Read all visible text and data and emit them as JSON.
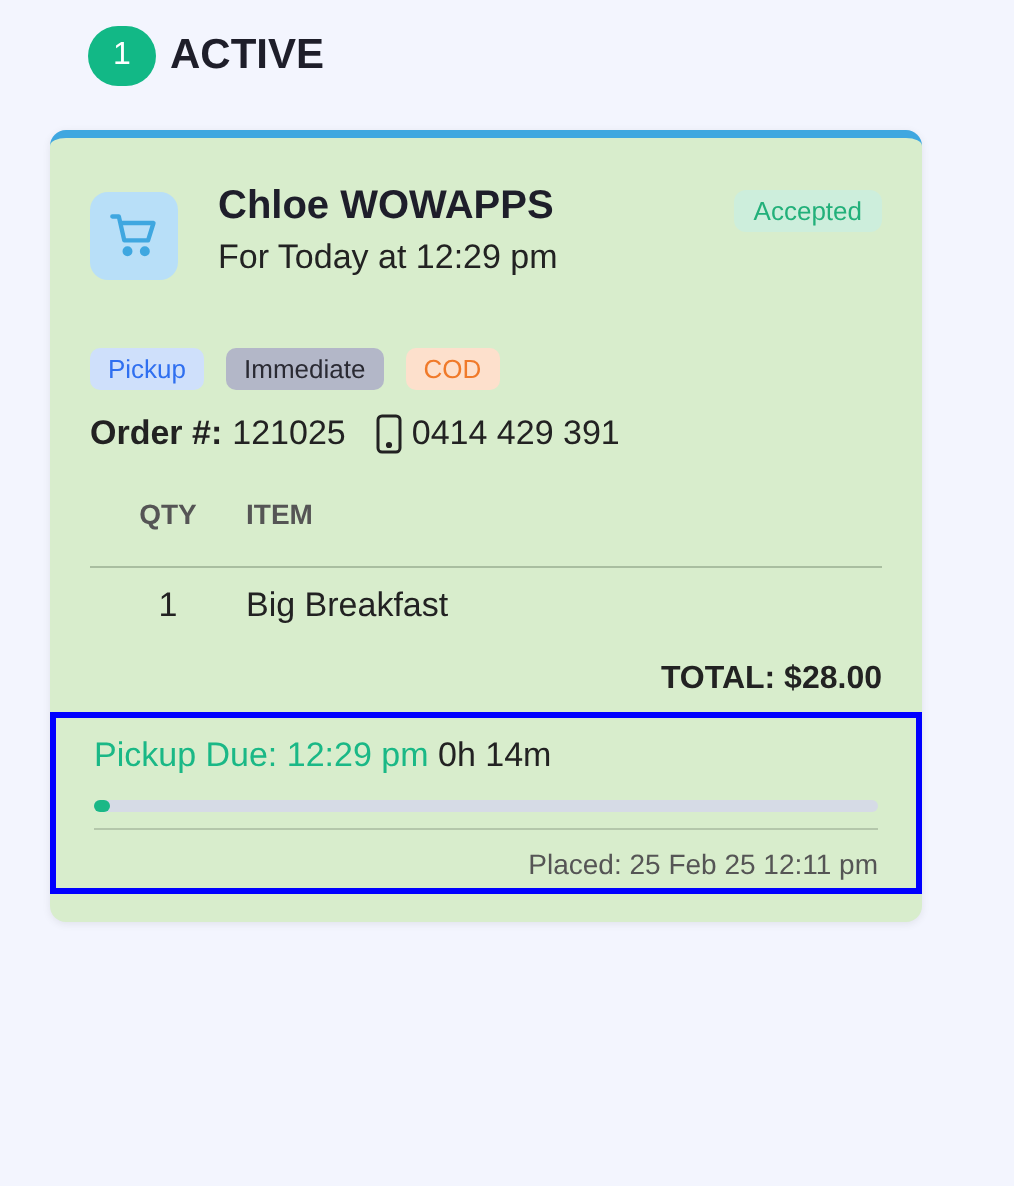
{
  "section": {
    "count": "1",
    "title": "ACTIVE"
  },
  "order": {
    "customer": "Chloe WOWAPPS",
    "schedule": "For Today at 12:29 pm",
    "status": "Accepted",
    "tags": [
      {
        "label": "Pickup",
        "kind": "method"
      },
      {
        "label": "Immediate",
        "kind": "timing"
      },
      {
        "label": "COD",
        "kind": "payment"
      }
    ],
    "order_label": "Order #:",
    "order_number": "121025",
    "phone": "0414 429 391",
    "columns": [
      "QTY",
      "ITEM"
    ],
    "items": [
      {
        "qty": "1",
        "item": "Big Breakfast"
      }
    ],
    "total": "TOTAL: $28.00",
    "footer": {
      "highlighted": true,
      "due": "Pickup Due: 12:29 pm",
      "remaining": "0h 14m",
      "level": 0.02,
      "placed": "Placed: 25 Feb 25 12:11 pm"
    }
  }
}
